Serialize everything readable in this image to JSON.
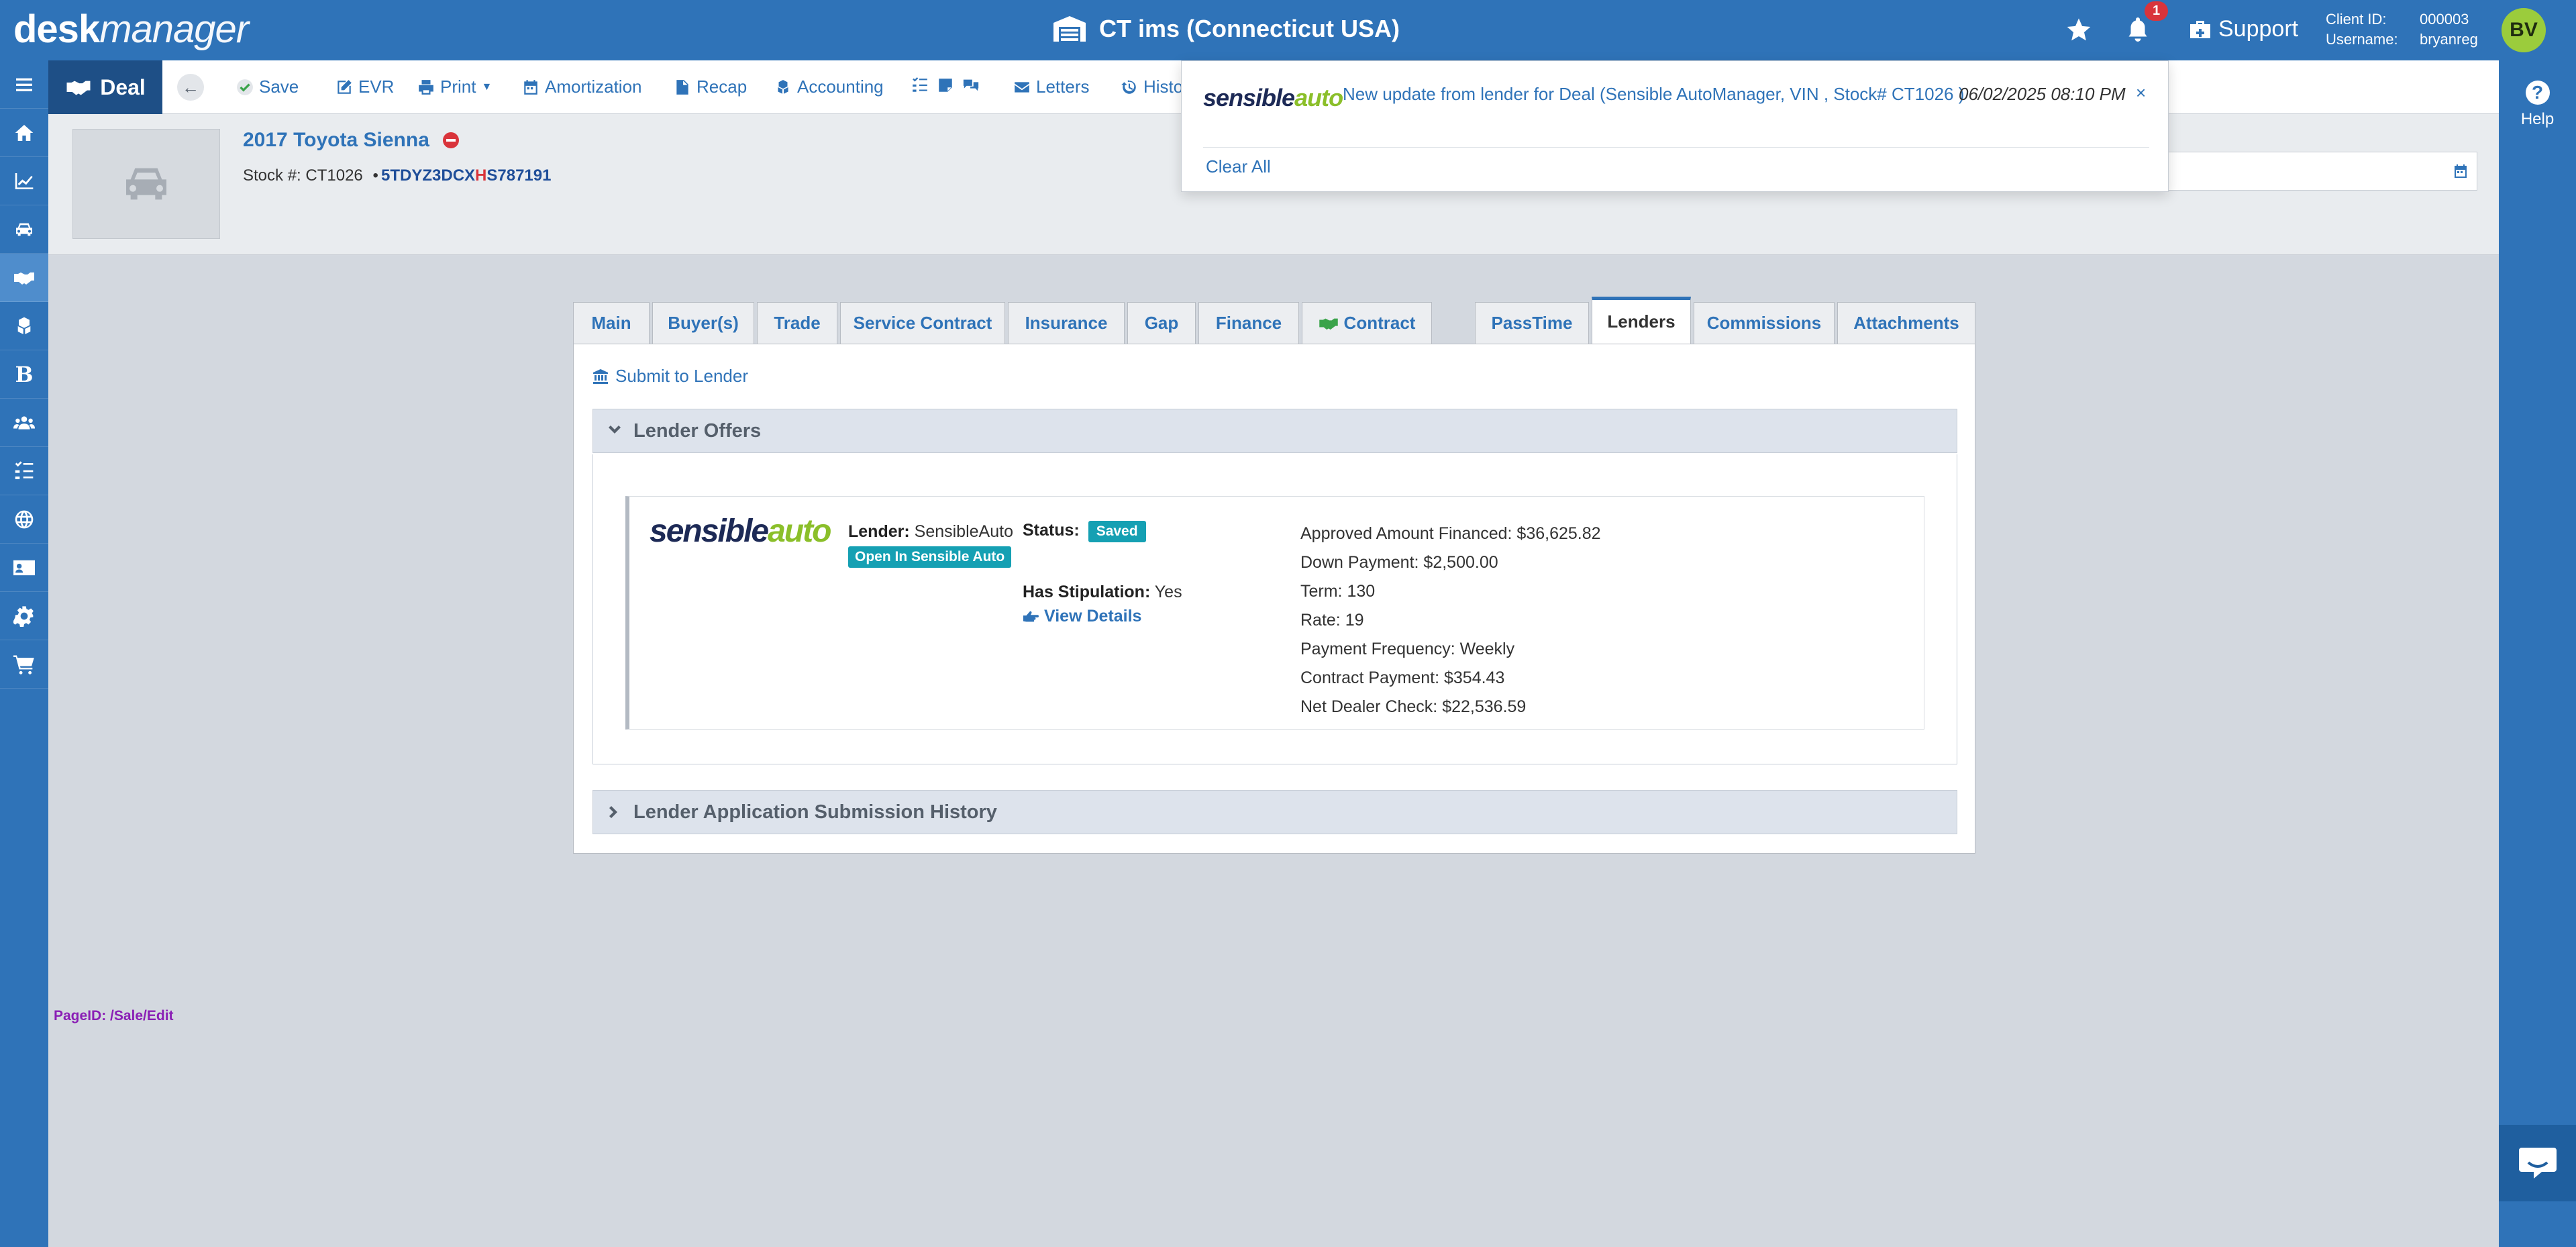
{
  "app": {
    "logo_bold": "desk",
    "logo_italic": "manager",
    "company": "CT ims (Connecticut USA)",
    "notification_count": "1",
    "support_label": "Support",
    "client_id_label": "Client ID:",
    "username_label": "Username:",
    "client_id": "000003",
    "username": "bryanreg",
    "avatar_initials": "BV",
    "help_label": "Help"
  },
  "toolbar": {
    "deal_label": "Deal",
    "save": "Save",
    "evr": "EVR",
    "print": "Print",
    "amortization": "Amortization",
    "recap": "Recap",
    "accounting": "Accounting",
    "letters": "Letters",
    "history": "Histo"
  },
  "vehicle": {
    "title": "2017 Toyota Sienna",
    "stock_label": "Stock #: CT1026",
    "separator": "•",
    "vin_a": "5TDYZ3DCX",
    "vin_b": "H",
    "vin_c": "S787191"
  },
  "notification": {
    "logo_a": "sensible",
    "logo_b": "auto",
    "message": "New update from lender for Deal (Sensible AutoManager, VIN , Stock# CT1026 )",
    "datetime": "06/02/2025 08:10 PM",
    "close": "×",
    "clear_all": "Clear All"
  },
  "tabs": [
    {
      "label": "Main"
    },
    {
      "label": "Buyer(s)"
    },
    {
      "label": "Trade"
    },
    {
      "label": "Service Contract"
    },
    {
      "label": "Insurance"
    },
    {
      "label": "Gap"
    },
    {
      "label": "Finance"
    },
    {
      "label": "Contract"
    },
    {
      "label": "PassTime"
    },
    {
      "label": "Lenders"
    },
    {
      "label": "Commissions"
    },
    {
      "label": "Attachments"
    }
  ],
  "lenders": {
    "submit_label": "Submit to Lender",
    "offers_header": "Lender Offers",
    "history_header": "Lender Application Submission History",
    "offer": {
      "logo_a": "sensible",
      "logo_b": "auto",
      "lender_label": "Lender:",
      "lender_value": "SensibleAuto",
      "open_button": "Open In Sensible Auto",
      "status_label": "Status:",
      "status_value": "Saved",
      "stip_label": "Has Stipulation:",
      "stip_value": "Yes",
      "view_details": "View Details",
      "terms": [
        "Approved Amount Financed: $36,625.82",
        "Down Payment: $2,500.00",
        "Term: 130",
        "Rate: 19",
        "Payment Frequency: Weekly",
        "Contract Payment: $354.43",
        "Net Dealer Check: $22,536.59"
      ]
    }
  },
  "footer": {
    "page_id": "PageID:  /Sale/Edit"
  },
  "colors": {
    "brand_blue": "#2f73b8",
    "deal_navy": "#1e4f86",
    "status_teal": "#15a0b3",
    "badge_red": "#d9343b",
    "avatar_green": "#9bcc3c"
  }
}
